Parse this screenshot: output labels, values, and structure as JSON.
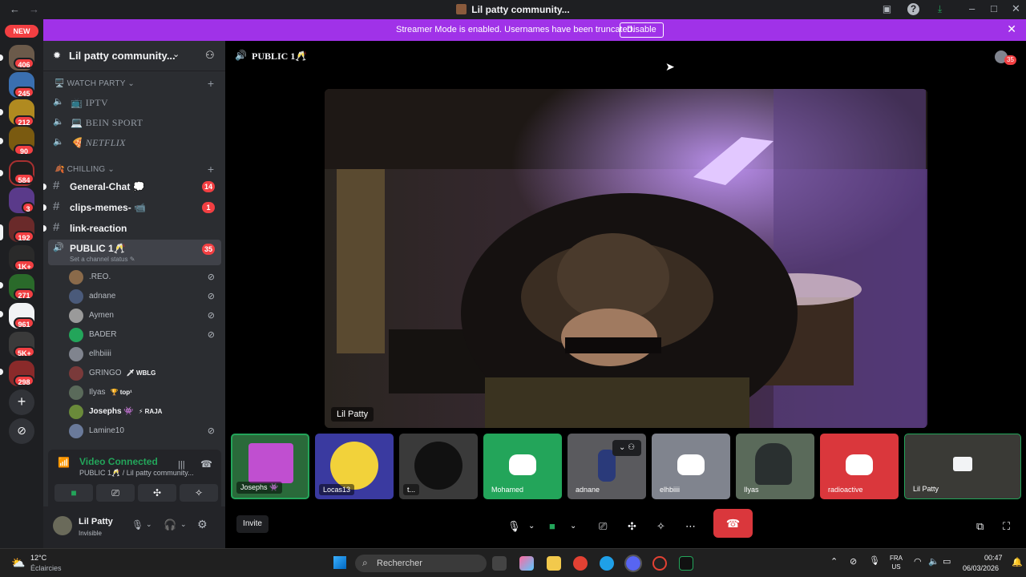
{
  "window": {
    "title": "Lil patty community..."
  },
  "banner": {
    "text": "Streamer Mode is enabled. Usernames have been truncated.",
    "button": "Disable"
  },
  "rail": {
    "new_label": "NEW",
    "badges": [
      "406",
      "245",
      "212",
      "90",
      "584",
      "3",
      "192",
      "1K+",
      "271",
      "961",
      "5K+",
      "298"
    ],
    "add_label": "+",
    "explore_label": "⊘"
  },
  "server": {
    "name": "Lil patty community..."
  },
  "categories": [
    {
      "name": "🖥️ WATCH PARTY ⌄"
    },
    {
      "name": "🍂 CHILLING ⌄"
    }
  ],
  "watch_channels": [
    {
      "icon": "📺",
      "label": "IPTV"
    },
    {
      "icon": "💻",
      "label": "BEIN SPORT"
    },
    {
      "icon": "🍕",
      "label": "NETFLIX"
    }
  ],
  "text_channels": [
    {
      "label": "General-Chat 💭",
      "badge": "14"
    },
    {
      "label": "clips-memes- 📹",
      "badge": "1"
    },
    {
      "label": "link-reaction",
      "badge": ""
    }
  ],
  "voice_channel": {
    "name": "PUBLIC 1🥂",
    "status": "Set a channel status ✎",
    "badge": "35"
  },
  "members": [
    {
      "name": ".REO.",
      "tag": "",
      "muted": true
    },
    {
      "name": "adnane",
      "tag": "",
      "muted": true
    },
    {
      "name": "Aymen",
      "tag": "",
      "muted": true
    },
    {
      "name": "BADER",
      "tag": "",
      "muted": true
    },
    {
      "name": "elhbiiii",
      "tag": "",
      "muted": true
    },
    {
      "name": "GRINGO",
      "tag": "🗡 WBLG",
      "muted": false
    },
    {
      "name": "Ilyas",
      "tag": "🏆 top¹",
      "muted": false
    },
    {
      "name": "Josephs 👾",
      "tag": "⚡ RAJA",
      "muted": false
    },
    {
      "name": "Lamine10",
      "tag": "",
      "muted": true
    }
  ],
  "voice_panel": {
    "status": "Video Connected",
    "sub": "PUBLIC 1🥂 / Lil patty community..."
  },
  "user": {
    "name": "Lil Patty",
    "status": "Invisible"
  },
  "stage": {
    "channel": "PUBLIC 1🥂",
    "viewer_count": "35",
    "main_video_name": "Lil Patty",
    "invite_label": "Invite",
    "tiles": [
      {
        "name": "Josephs 👾"
      },
      {
        "name": "Locas13"
      },
      {
        "name": "t..."
      },
      {
        "name": "Mohamed"
      },
      {
        "name": "adnane"
      },
      {
        "name": "elhbiiii"
      },
      {
        "name": "Ilyas"
      },
      {
        "name": "radioactive"
      },
      {
        "name": "Lil Patty"
      }
    ]
  },
  "taskbar": {
    "weather_temp": "12°C",
    "weather_desc": "Éclaircies",
    "search_placeholder": "Rechercher",
    "lang_1": "FRA",
    "lang_2": "US",
    "time": "00:47",
    "date": "06/03/2026"
  },
  "colors": {
    "accent": "#5865f2",
    "banner": "#a032e8",
    "danger": "#da373c",
    "online": "#23a55a"
  }
}
